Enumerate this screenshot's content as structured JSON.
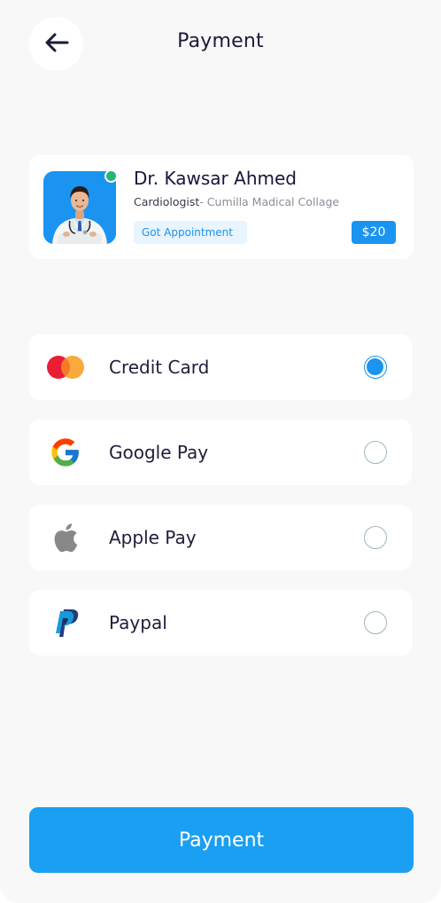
{
  "header": {
    "title": "Payment",
    "back_icon": "arrow-left-icon"
  },
  "doctor": {
    "name": "Dr. Kawsar Ahmed",
    "specialty": "Cardiologist",
    "place": "- Cumilla Madical Collage",
    "status_badge": "Got Appointment",
    "price": "$20",
    "online": true,
    "avatar_icon": "doctor-avatar",
    "accent_color": "#1a94f0",
    "online_color": "#2ab27b"
  },
  "payment_methods": [
    {
      "id": "credit-card",
      "label": "Credit Card",
      "icon": "mastercard-icon",
      "selected": true
    },
    {
      "id": "google-pay",
      "label": "Google Pay",
      "icon": "google-icon",
      "selected": false
    },
    {
      "id": "apple-pay",
      "label": "Apple Pay",
      "icon": "apple-icon",
      "selected": false
    },
    {
      "id": "paypal",
      "label": "Paypal",
      "icon": "paypal-icon",
      "selected": false
    }
  ],
  "footer": {
    "button_label": "Payment",
    "button_color": "#1a9ff2"
  }
}
